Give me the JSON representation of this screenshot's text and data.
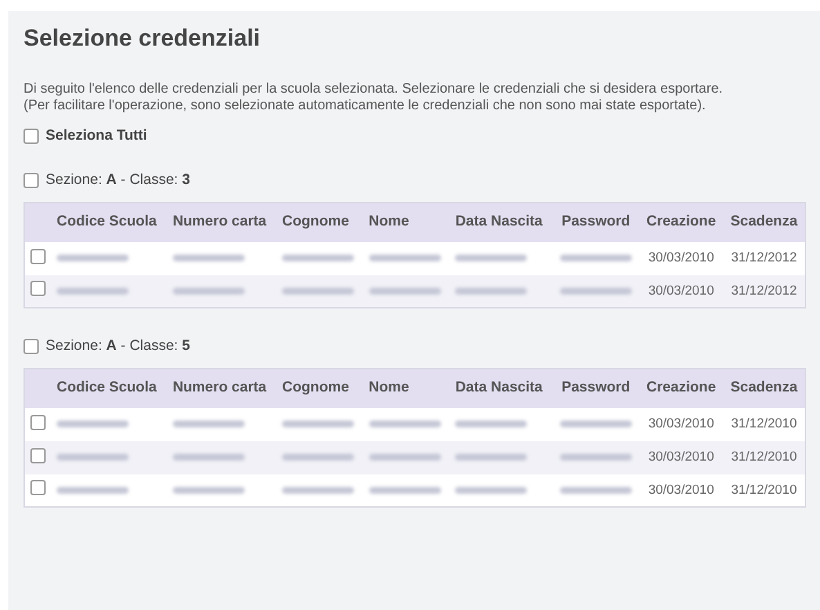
{
  "title": "Selezione credenziali",
  "intro": [
    "Di seguito l'elenco delle credenziali per la scuola selezionata. Selezionare le credenziali che si desidera esportare.",
    "(Per facilitare l'operazione, sono selezionate automaticamente le credenziali che non sono mai state esportate)."
  ],
  "select_all": {
    "label": "Seleziona Tutti",
    "checked": false
  },
  "groups": [
    {
      "label": "Sezione: **A** - Classe: **3**",
      "checked": false,
      "columns": [
        "Codice Scuola",
        "Numero carta",
        "Cognome",
        "Nome",
        "Data Nascita",
        "Password",
        "Creazione",
        "Scadenza"
      ],
      "rows": [
        {
          "checked": false,
          "cells": [
            {
              "kind": "redacted"
            },
            {
              "kind": "redacted"
            },
            {
              "kind": "redacted"
            },
            {
              "kind": "redacted"
            },
            {
              "kind": "redacted"
            },
            {
              "kind": "redacted"
            },
            {
              "kind": "text",
              "text": "30/03/2010"
            },
            {
              "kind": "text",
              "text": "31/12/2012"
            }
          ]
        },
        {
          "checked": false,
          "cells": [
            {
              "kind": "redacted"
            },
            {
              "kind": "redacted"
            },
            {
              "kind": "redacted"
            },
            {
              "kind": "redacted"
            },
            {
              "kind": "redacted"
            },
            {
              "kind": "redacted"
            },
            {
              "kind": "text",
              "text": "30/03/2010"
            },
            {
              "kind": "text",
              "text": "31/12/2012"
            }
          ]
        }
      ]
    },
    {
      "label": "Sezione: **A** - Classe: **5**",
      "checked": false,
      "columns": [
        "Codice Scuola",
        "Numero carta",
        "Cognome",
        "Nome",
        "Data Nascita",
        "Password",
        "Creazione",
        "Scadenza"
      ],
      "rows": [
        {
          "checked": false,
          "cells": [
            {
              "kind": "redacted"
            },
            {
              "kind": "redacted"
            },
            {
              "kind": "redacted"
            },
            {
              "kind": "redacted"
            },
            {
              "kind": "redacted"
            },
            {
              "kind": "redacted"
            },
            {
              "kind": "text",
              "text": "30/03/2010"
            },
            {
              "kind": "text",
              "text": "31/12/2010"
            }
          ]
        },
        {
          "checked": false,
          "cells": [
            {
              "kind": "redacted"
            },
            {
              "kind": "redacted"
            },
            {
              "kind": "redacted"
            },
            {
              "kind": "redacted"
            },
            {
              "kind": "redacted"
            },
            {
              "kind": "redacted"
            },
            {
              "kind": "text",
              "text": "30/03/2010"
            },
            {
              "kind": "text",
              "text": "31/12/2010"
            }
          ]
        },
        {
          "checked": false,
          "cells": [
            {
              "kind": "redacted"
            },
            {
              "kind": "redacted"
            },
            {
              "kind": "redacted"
            },
            {
              "kind": "redacted"
            },
            {
              "kind": "redacted"
            },
            {
              "kind": "redacted"
            },
            {
              "kind": "text",
              "text": "30/03/2010"
            },
            {
              "kind": "text",
              "text": "31/12/2010"
            }
          ]
        }
      ]
    }
  ]
}
